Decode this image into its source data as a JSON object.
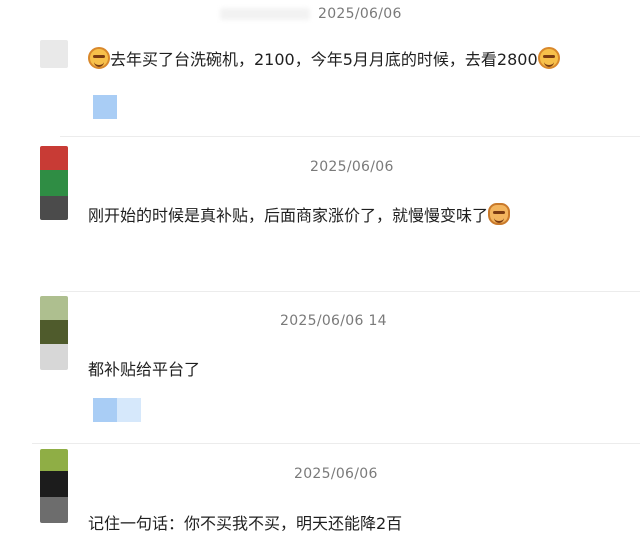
{
  "comments": [
    {
      "timestamp": "2025/06/06",
      "text": "去年买了台洗碗机，2100，今年5月月底的时候，去看2800",
      "lead_icon": "grinning-cat-emoji-icon",
      "trail_icon": "smirk-emoji-icon"
    },
    {
      "timestamp": "2025/06/06",
      "text": "刚开始的时候是真补贴，后面商家涨价了，就慢慢变味了",
      "trail_icon": "bear-emoji-icon"
    },
    {
      "timestamp": "2025/06/06 14",
      "text": "都补贴给平台了"
    },
    {
      "timestamp": "2025/06/06",
      "text": "记住一句话：你不买我不买，明天还能降2百"
    }
  ],
  "colors": {
    "reaction_blue": "#a9cdf5",
    "reaction_blue_light": "#d6e8fb"
  }
}
